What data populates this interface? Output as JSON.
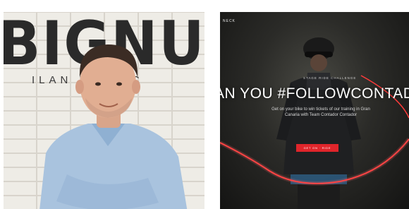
{
  "left_photo": {
    "mural_text": "BIGNUV",
    "mural_subtext": "ILAN    NA  ACC"
  },
  "right_screenshot": {
    "brand": "NECK",
    "eyebrow": "STAGE RIDE CHALLENGE",
    "headline": "AN YOU #FOLLOWCONTADOR",
    "subtext": "Get on your bike to win tickets of our training in Gran Canaria with Team Contador Contador",
    "cta_label": "GET ON · RIDE",
    "colors": {
      "accent": "#e0252b",
      "route_line": "#ff3b3b"
    }
  }
}
